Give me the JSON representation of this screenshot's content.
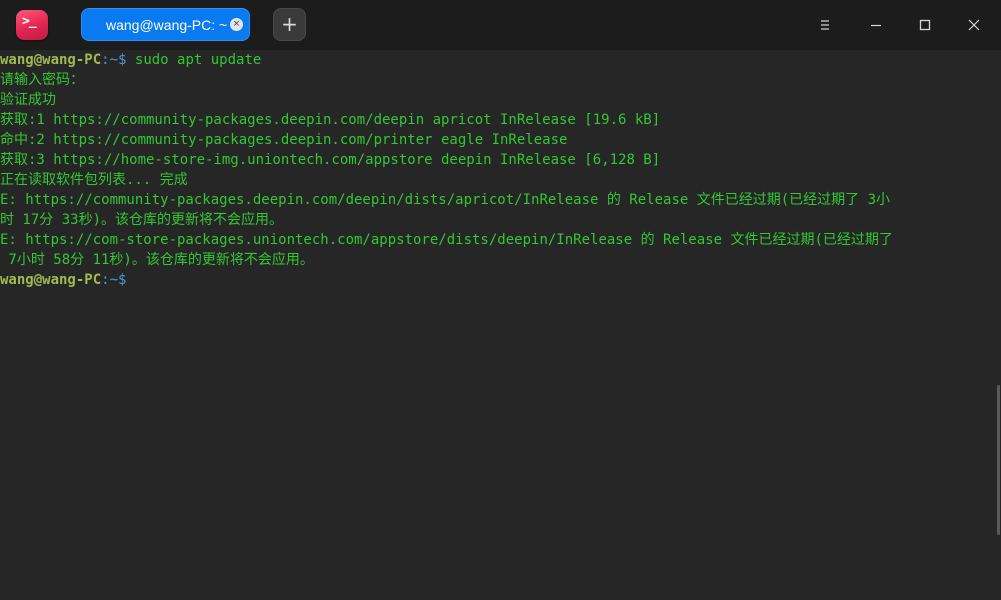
{
  "window": {
    "app_icon_glyph": ">_",
    "tab": {
      "label": "wang@wang-PC: ~",
      "close_glyph": "×"
    },
    "new_tab_glyph": "+",
    "controls": [
      "menu-icon",
      "minimize-icon",
      "maximize-icon",
      "close-icon"
    ]
  },
  "colors": {
    "terminal_bg": "#262626",
    "titlebar_bg": "#1c1c1c",
    "tab_active": "#0a7af0",
    "output_green": "#32c832",
    "prompt_user": "#a3b84f",
    "prompt_path": "#4a9ad6"
  },
  "terminal": {
    "prompt_user": "wang@wang-PC",
    "prompt_sep": ":",
    "prompt_path": "~",
    "prompt_sign": "$ ",
    "command": "sudo apt update",
    "lines": [
      "请输入密码：",
      "验证成功",
      "获取:1 https://community-packages.deepin.com/deepin apricot InRelease [19.6 kB]",
      "命中:2 https://community-packages.deepin.com/printer eagle InRelease",
      "获取:3 https://home-store-img.uniontech.com/appstore deepin InRelease [6,128 B]",
      "正在读取软件包列表... 完成",
      "E: https://community-packages.deepin.com/deepin/dists/apricot/InRelease 的 Release 文件已经过期(已经过期了 3小",
      "时 17分 33秒)。该仓库的更新将不会应用。",
      "E: https://com-store-packages.uniontech.com/appstore/dists/deepin/InRelease 的 Release 文件已经过期(已经过期了",
      " 7小时 58分 11秒)。该仓库的更新将不会应用。"
    ],
    "prompt2_user": "wang@wang-PC",
    "prompt2_sep": ":",
    "prompt2_path": "~",
    "prompt2_sign": "$"
  }
}
